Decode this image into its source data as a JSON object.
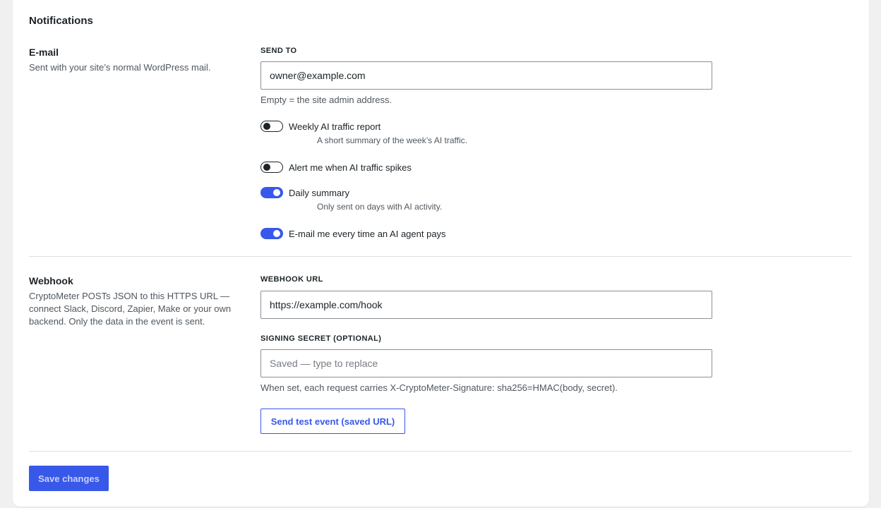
{
  "notifications": {
    "title": "Notifications",
    "email": {
      "title": "E-mail",
      "description": "Sent with your site’s normal WordPress mail.",
      "send_to_label": "SEND TO",
      "send_to_value": "owner@example.com",
      "send_to_help": "Empty = the site admin address.",
      "toggles": [
        {
          "label": "Weekly AI traffic report",
          "description": "A short summary of the week’s AI traffic.",
          "enabled": false
        },
        {
          "label": "Alert me when AI traffic spikes",
          "description": "",
          "enabled": false
        },
        {
          "label": "Daily summary",
          "description": "Only sent on days with AI activity.",
          "enabled": true
        },
        {
          "label": "E-mail me every time an AI agent pays",
          "description": "",
          "enabled": true
        }
      ]
    },
    "webhook": {
      "title": "Webhook",
      "description": "CryptoMeter POSTs JSON to this HTTPS URL — connect Slack, Discord, Zapier, Make or your own backend. Only the data in the event is sent.",
      "url_label": "WEBHOOK URL",
      "url_value": "https://example.com/hook",
      "secret_label": "SIGNING SECRET (OPTIONAL)",
      "secret_placeholder": "Saved — type to replace",
      "secret_help": "When set, each request carries X-CryptoMeter-Signature: sha256=HMAC(body, secret).",
      "test_button": "Send test event (saved URL)"
    },
    "save_button": "Save changes"
  },
  "colors": {
    "accent": "#3858e9",
    "background": "#f0f0f1",
    "card": "#ffffff",
    "text": "#1d2327",
    "muted": "#50575e"
  }
}
